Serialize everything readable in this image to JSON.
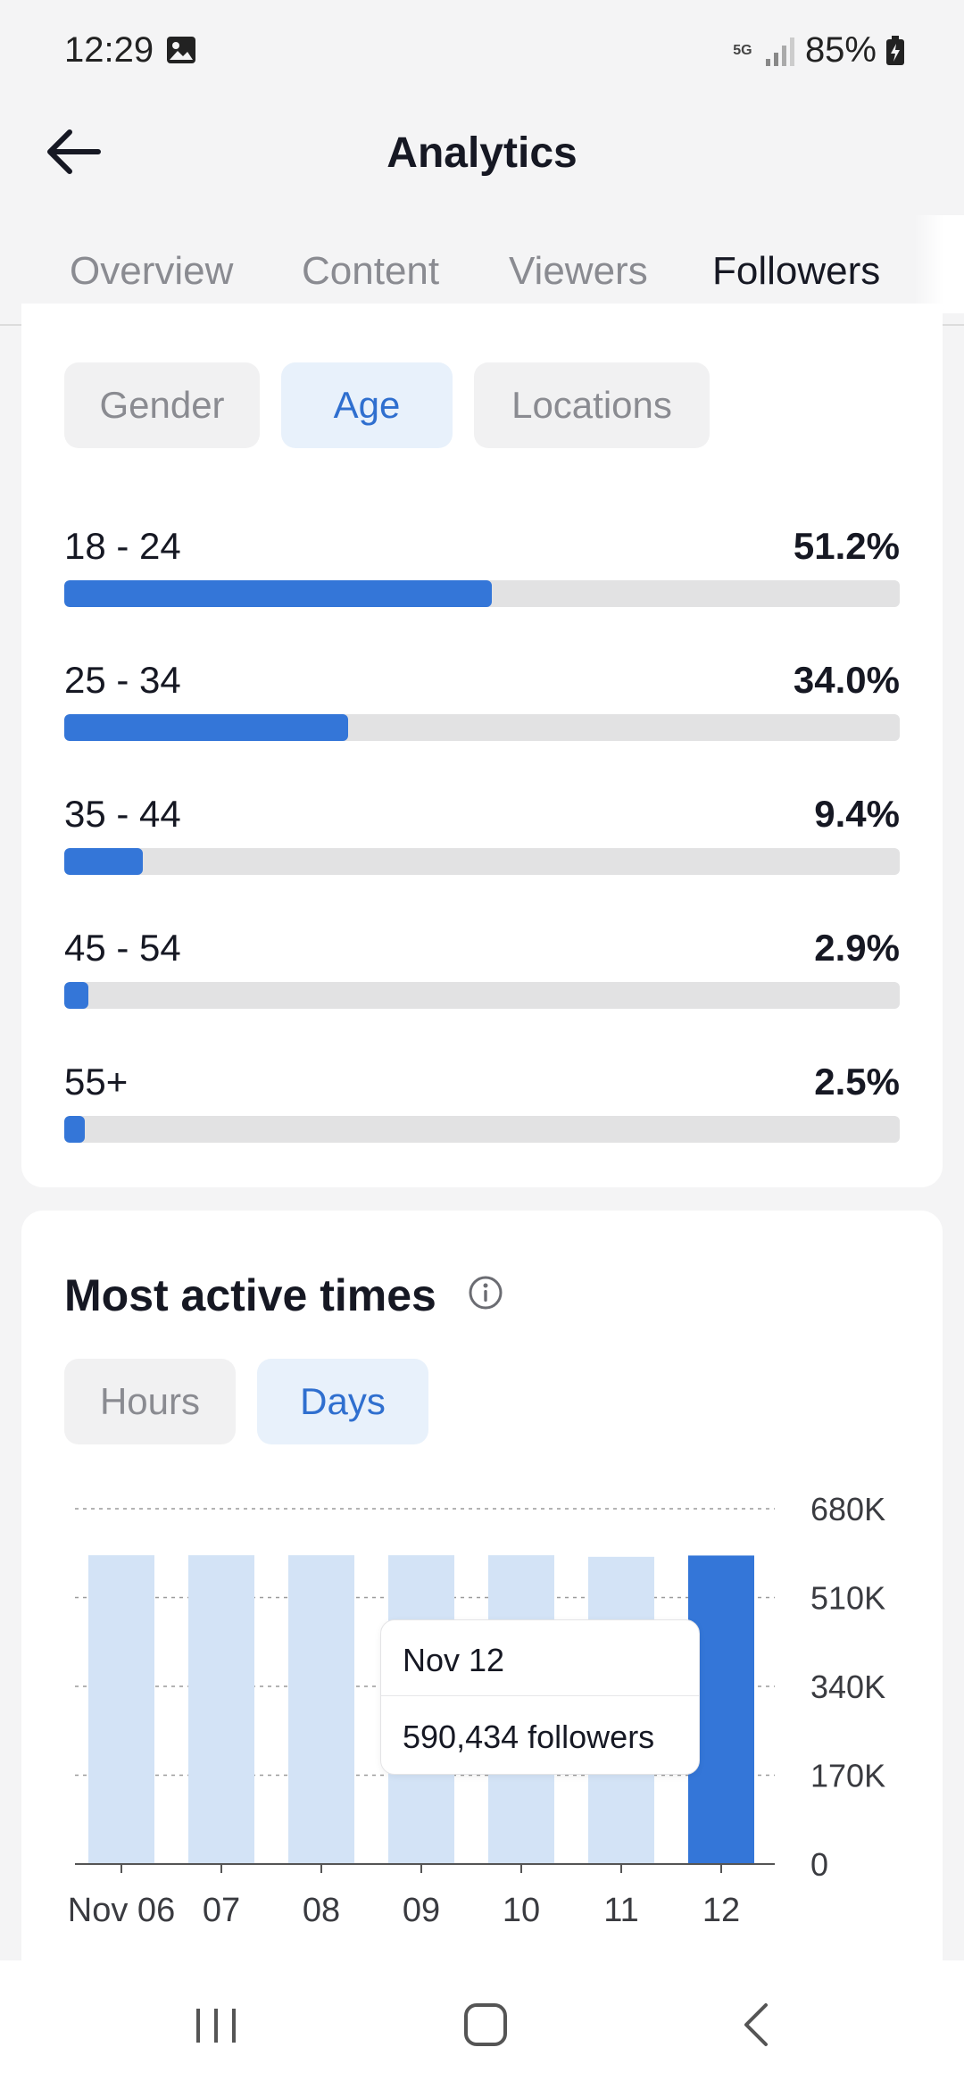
{
  "status_bar": {
    "time": "12:29",
    "network": "5G",
    "battery": "85%"
  },
  "header": {
    "title": "Analytics"
  },
  "tabs": [
    {
      "label": "Overview",
      "active": false
    },
    {
      "label": "Content",
      "active": false
    },
    {
      "label": "Viewers",
      "active": false
    },
    {
      "label": "Followers",
      "active": true
    }
  ],
  "demographics": {
    "chips": [
      {
        "label": "Gender",
        "active": false
      },
      {
        "label": "Age",
        "active": true
      },
      {
        "label": "Locations",
        "active": false
      }
    ],
    "age_groups": [
      {
        "label": "18 - 24",
        "value": "51.2%",
        "fraction": 0.512
      },
      {
        "label": "25 - 34",
        "value": "34.0%",
        "fraction": 0.34
      },
      {
        "label": "35 - 44",
        "value": "9.4%",
        "fraction": 0.094
      },
      {
        "label": "45 - 54",
        "value": "2.9%",
        "fraction": 0.029
      },
      {
        "label": "55+",
        "value": "2.5%",
        "fraction": 0.025
      }
    ]
  },
  "most_active": {
    "title": "Most active times",
    "chips": [
      {
        "label": "Hours",
        "active": false
      },
      {
        "label": "Days",
        "active": true
      }
    ],
    "tooltip": {
      "date": "Nov 12",
      "value": "590,434 followers"
    }
  },
  "chart_data": {
    "type": "bar",
    "categories": [
      "Nov 06",
      "07",
      "08",
      "09",
      "10",
      "11",
      "12"
    ],
    "values": [
      591000,
      591000,
      591000,
      591000,
      591000,
      588000,
      590434
    ],
    "highlighted_index": 6,
    "ylim": [
      0,
      680000
    ],
    "yticks": [
      {
        "value": 680000,
        "label": "680K"
      },
      {
        "value": 510000,
        "label": "510K"
      },
      {
        "value": 340000,
        "label": "340K"
      },
      {
        "value": 170000,
        "label": "170K"
      },
      {
        "value": 0,
        "label": "0"
      }
    ],
    "colors": {
      "bar": "#d3e3f6",
      "highlight": "#3476d8",
      "grid": "#9a9a9a"
    }
  },
  "colors": {
    "accent": "#3476d8",
    "accent_chip_bg": "#e8f1fb",
    "text": "#161823",
    "muted": "#8a8b91"
  }
}
